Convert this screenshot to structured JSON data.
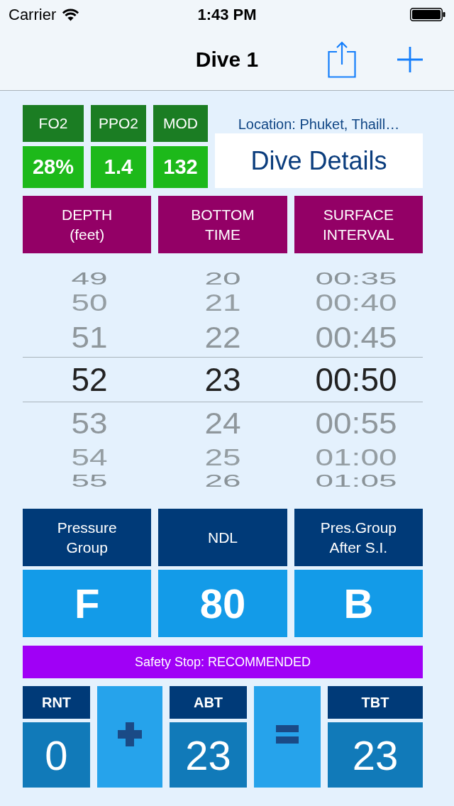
{
  "status_bar": {
    "carrier": "Carrier",
    "time": "1:43 PM"
  },
  "nav_bar": {
    "title": "Dive 1"
  },
  "gas": [
    {
      "label": "FO2",
      "value": "28%"
    },
    {
      "label": "PPO2",
      "value": "1.4"
    },
    {
      "label": "MOD",
      "value": "132"
    }
  ],
  "location": "Location: Phuket, Thaill…",
  "details_button": {
    "label": "Dive Details"
  },
  "pickers": [
    {
      "header": [
        "DEPTH",
        "(feet)"
      ],
      "items": [
        {
          "text": "49",
          "selected": false
        },
        {
          "text": "50",
          "selected": false
        },
        {
          "text": "51",
          "selected": false
        },
        {
          "text": "52",
          "selected": true
        },
        {
          "text": "53",
          "selected": false
        },
        {
          "text": "54",
          "selected": false
        },
        {
          "text": "55",
          "selected": false
        }
      ]
    },
    {
      "header": [
        "BOTTOM",
        "TIME"
      ],
      "items": [
        {
          "text": "20",
          "selected": false
        },
        {
          "text": "21",
          "selected": false
        },
        {
          "text": "22",
          "selected": false
        },
        {
          "text": "23",
          "selected": true
        },
        {
          "text": "24",
          "selected": false
        },
        {
          "text": "25",
          "selected": false
        },
        {
          "text": "26",
          "selected": false
        }
      ]
    },
    {
      "header": [
        "SURFACE",
        "INTERVAL"
      ],
      "items": [
        {
          "text": "00:35",
          "selected": false
        },
        {
          "text": "00:40",
          "selected": false
        },
        {
          "text": "00:45",
          "selected": false
        },
        {
          "text": "00:50",
          "selected": true
        },
        {
          "text": "00:55",
          "selected": false
        },
        {
          "text": "01:00",
          "selected": false
        },
        {
          "text": "01:05",
          "selected": false
        }
      ]
    }
  ],
  "results": [
    {
      "label": [
        "Pressure",
        "Group"
      ],
      "value": "F"
    },
    {
      "label": [
        "NDL"
      ],
      "value": "80"
    },
    {
      "label": [
        "Pres.Group",
        "After S.I."
      ],
      "value": "B"
    }
  ],
  "safety_stop": "Safety Stop: RECOMMENDED",
  "totals": [
    {
      "kind": "value",
      "label": "RNT",
      "value": "0"
    },
    {
      "kind": "plus"
    },
    {
      "kind": "value",
      "label": "ABT",
      "value": "23"
    },
    {
      "kind": "equals"
    },
    {
      "kind": "value",
      "label": "TBT",
      "value": "23"
    }
  ]
}
